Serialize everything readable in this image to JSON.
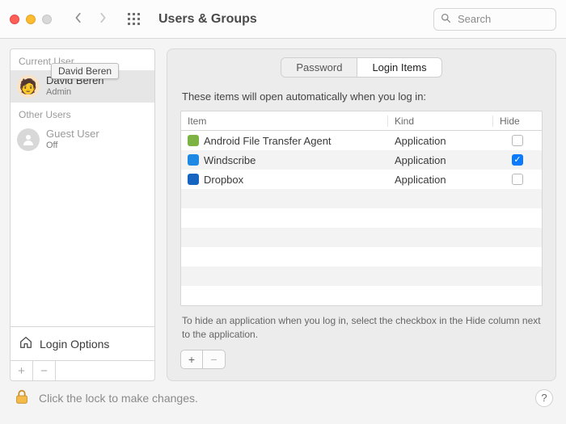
{
  "header": {
    "title": "Users & Groups",
    "search_placeholder": "Search"
  },
  "tabs": {
    "password": "Password",
    "login_items": "Login Items",
    "active": "login_items"
  },
  "sidebar": {
    "current_label": "Current User",
    "other_label": "Other Users",
    "current_user": {
      "name": "David Beren",
      "role": "Admin",
      "tooltip": "David Beren"
    },
    "other_users": [
      {
        "name": "Guest User",
        "role": "Off"
      }
    ],
    "login_options_label": "Login Options"
  },
  "panel": {
    "intro": "These items will open automatically when you log in:",
    "columns": {
      "item": "Item",
      "kind": "Kind",
      "hide": "Hide"
    },
    "rows": [
      {
        "icon": "android",
        "name": "Android File Transfer Agent",
        "kind": "Application",
        "hide": false
      },
      {
        "icon": "wind",
        "name": "Windscribe",
        "kind": "Application",
        "hide": true
      },
      {
        "icon": "drop",
        "name": "Dropbox",
        "kind": "Application",
        "hide": false
      }
    ],
    "blank_rows": 6,
    "hint": "To hide an application when you log in, select the checkbox in the Hide column next to the application."
  },
  "footer": {
    "lock_text": "Click the lock to make changes.",
    "help": "?"
  }
}
